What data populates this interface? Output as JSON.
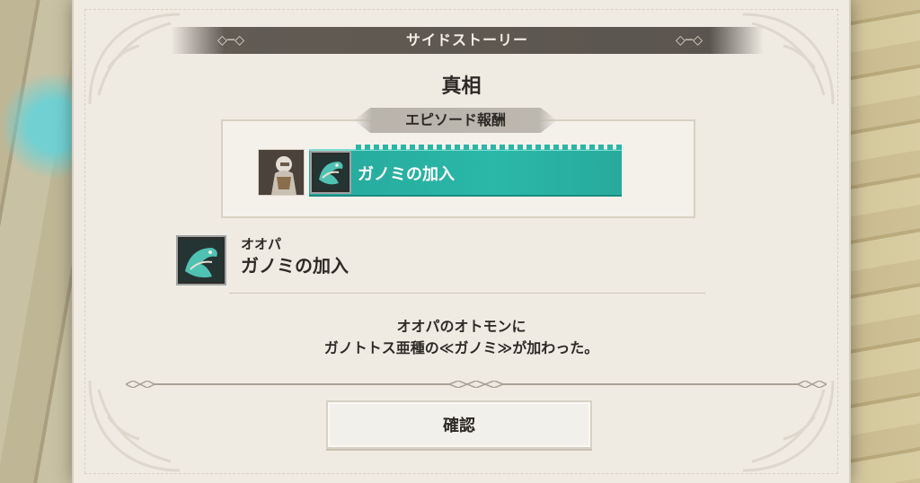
{
  "dialog": {
    "title": "サイドストーリー",
    "heading": "真相"
  },
  "reward": {
    "section_label": "エピソード報酬",
    "item_label": "ガノミの加入"
  },
  "detail": {
    "owner": "オオパ",
    "title": "ガノミの加入",
    "description_line1": "オオパのオトモンに",
    "description_line2": "ガノトトス亜種の≪ガノミ≫が加わった。"
  },
  "buttons": {
    "confirm_label": "確認"
  },
  "colors": {
    "accent_teal": "#2ab8a8",
    "ribbon_dark": "#5b554f",
    "parchment": "#efebe3"
  },
  "icons": {
    "reward_item": "gyanomi-monstie-icon",
    "detail_item": "gyanomi-monstie-icon",
    "portrait": "oopa-portrait"
  }
}
